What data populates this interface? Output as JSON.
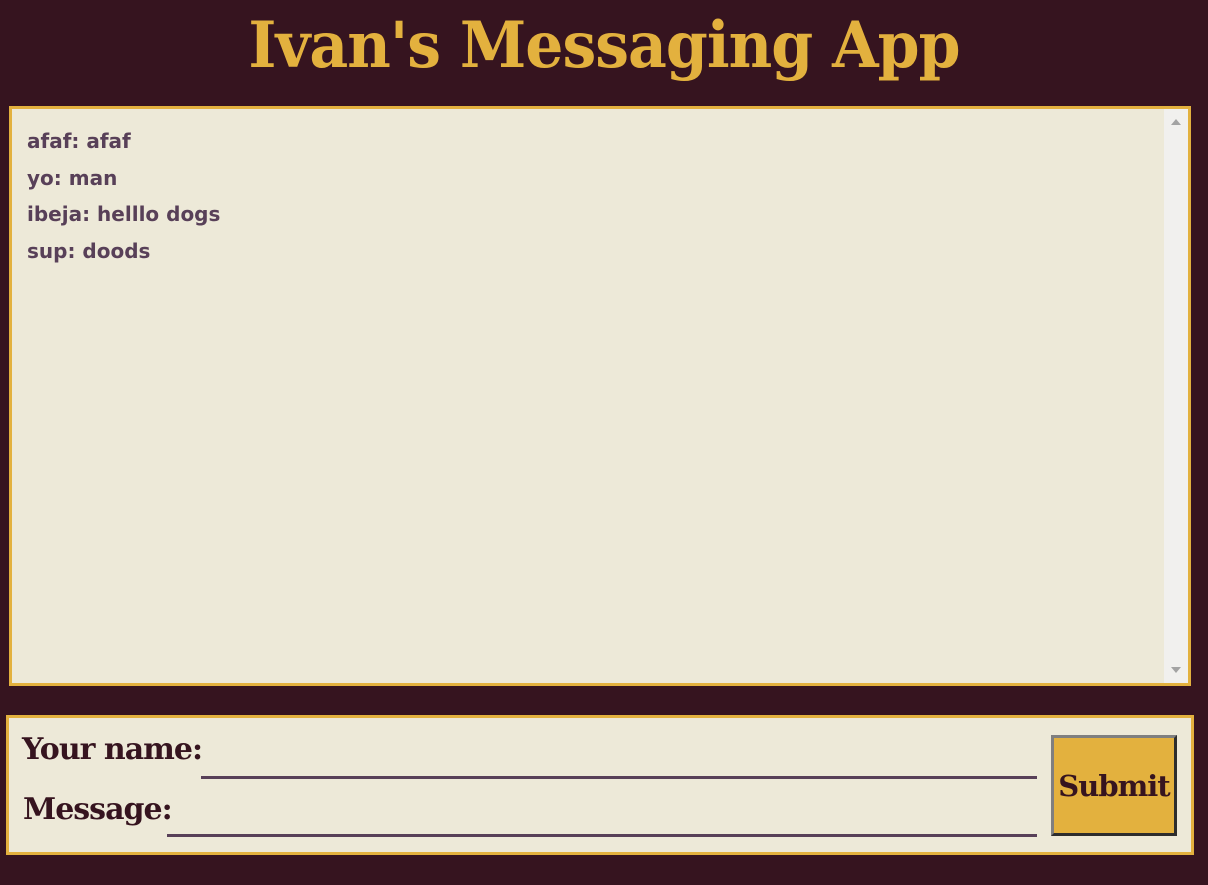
{
  "app": {
    "title": "Ivan's Messaging App"
  },
  "messages": [
    {
      "text": "afaf: afaf"
    },
    {
      "text": "yo: man"
    },
    {
      "text": "ibeja: helllo dogs"
    },
    {
      "text": "sup: doods"
    }
  ],
  "form": {
    "name_label": "Your name:",
    "name_value": "",
    "message_label": "Message:",
    "message_value": "",
    "submit_label": "Submit"
  },
  "colors": {
    "background": "#36141f",
    "accent": "#e3b13e",
    "panel": "#ede9d8",
    "message_text": "#584058"
  },
  "icons": {
    "scroll_up": "scroll-up-arrow-icon",
    "scroll_down": "scroll-down-arrow-icon"
  }
}
